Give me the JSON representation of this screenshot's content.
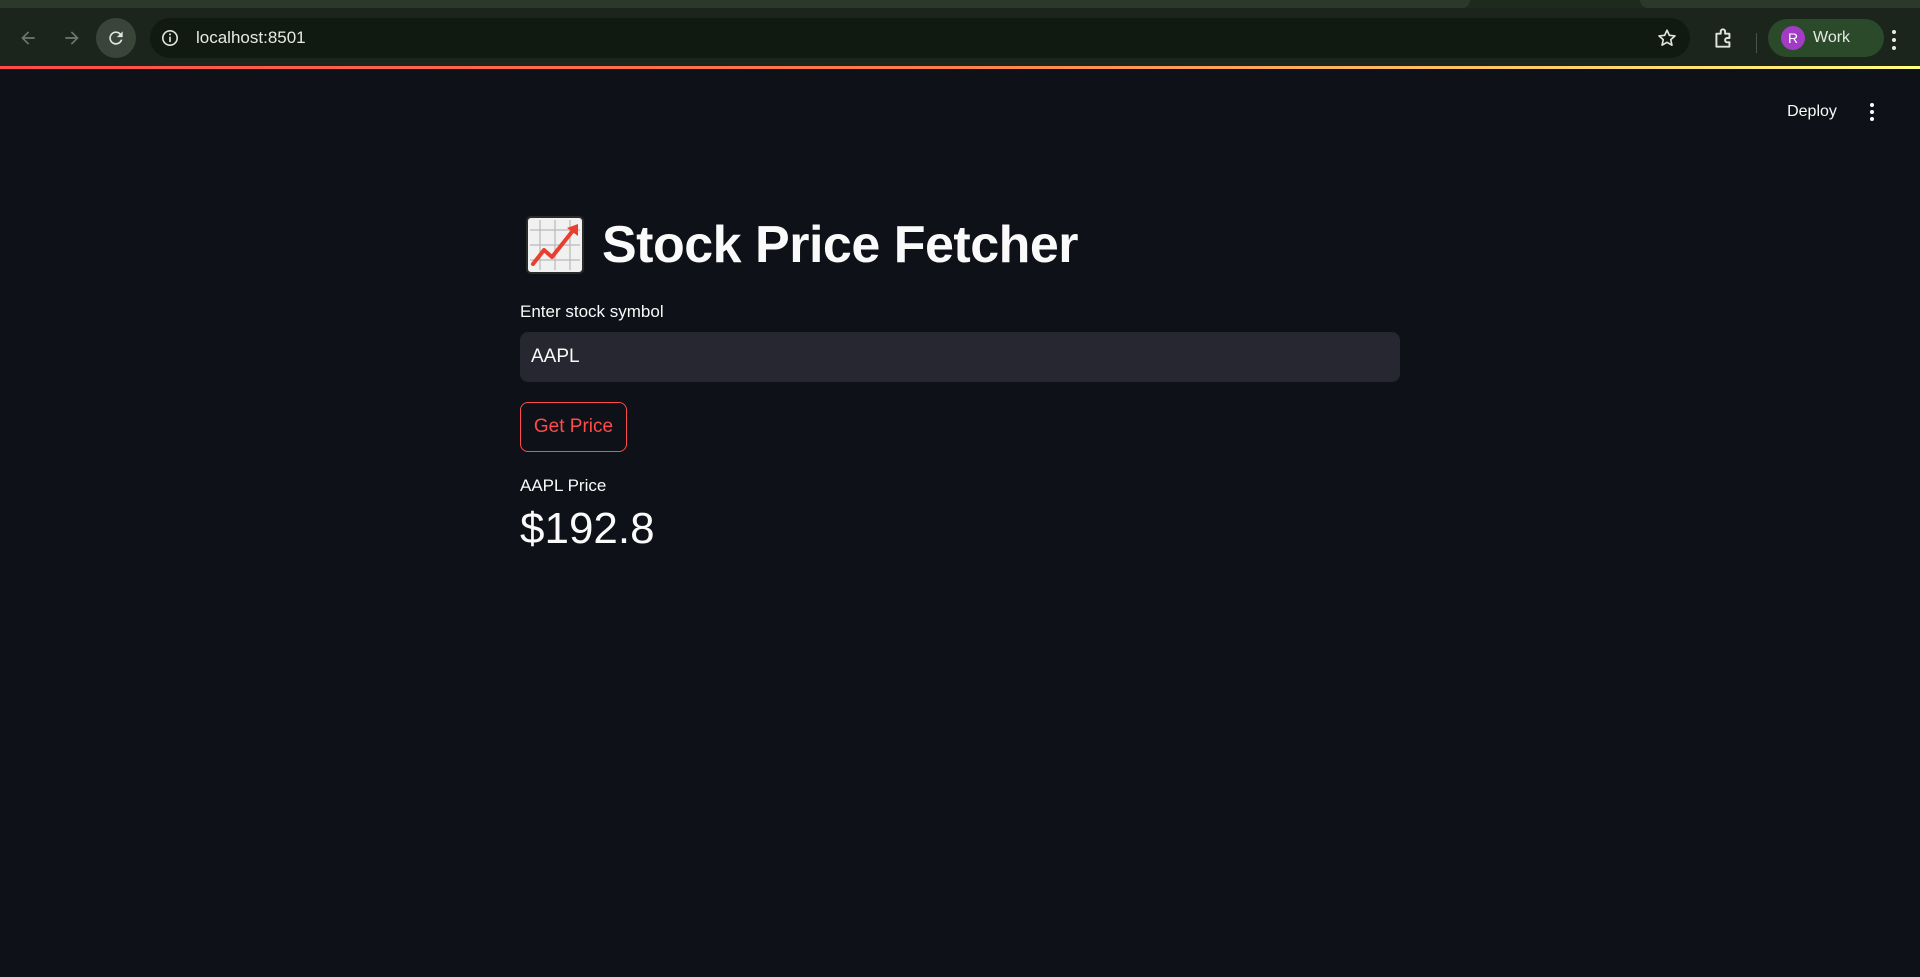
{
  "browser": {
    "url": "localhost:8501",
    "profile_initial": "R",
    "profile_label": "Work"
  },
  "header": {
    "deploy_label": "Deploy"
  },
  "main": {
    "title_emoji": "chart-increasing-icon",
    "title": "Stock Price Fetcher",
    "input_label": "Enter stock symbol",
    "input_value": "AAPL",
    "button_label": "Get Price",
    "metric_label": "AAPL Price",
    "metric_value": "$192.8"
  },
  "colors": {
    "app_background": "#0e1117",
    "primary": "#ff4b4b",
    "input_background": "#262730",
    "browser_toolbar": "#1c251c",
    "profile_avatar": "#a23cc4"
  }
}
